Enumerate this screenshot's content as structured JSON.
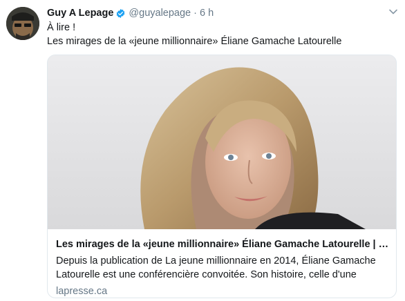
{
  "tweet": {
    "author_name": "Guy A Lepage",
    "handle": "@guyalepage",
    "separator": "·",
    "time": "6 h",
    "lines": [
      "À lire !",
      "Les mirages de la «jeune millionnaire» Éliane Gamache Latourelle"
    ]
  },
  "card": {
    "title": "Les mirages de la «jeune millionnaire» Éliane Gamache Latourelle | N...",
    "description": "Depuis la publication de La jeune millionnaire en 2014, Éliane Gamache Latourelle est une conférencière convoitée. Son histoire, celle d'une",
    "domain": "lapresse.ca"
  },
  "icons": {
    "verified": "verified-badge-icon",
    "caret": "chevron-down-icon"
  },
  "colors": {
    "verified_blue": "#1da1f2",
    "secondary_text": "#657786",
    "border": "#e1e8ed"
  }
}
